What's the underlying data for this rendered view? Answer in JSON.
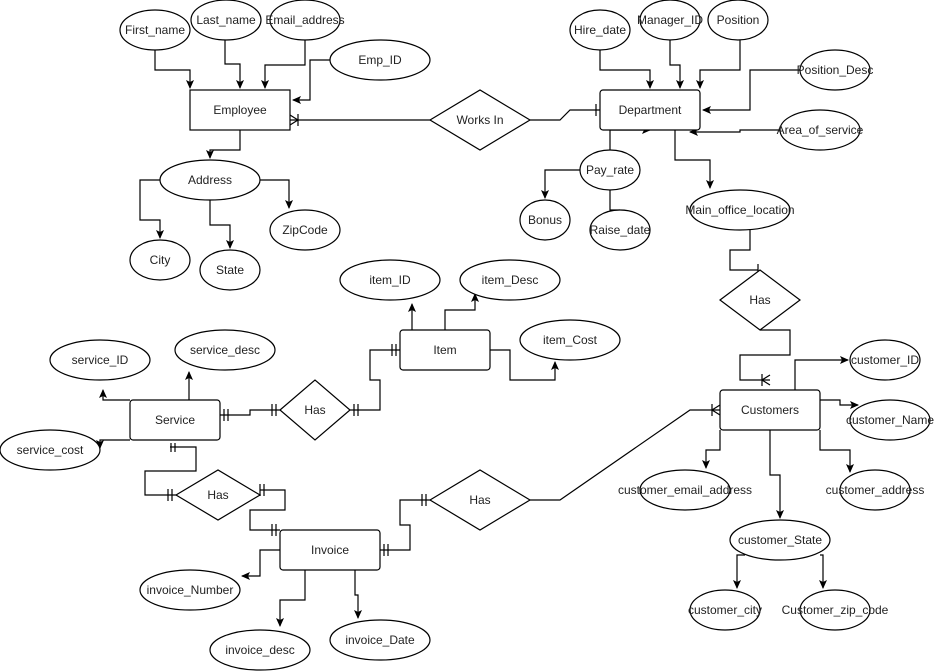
{
  "diagram": {
    "type": "ER diagram",
    "entities": {
      "employee": "Employee",
      "department": "Department",
      "item": "Item",
      "service": "Service",
      "invoice": "Invoice",
      "customers": "Customers"
    },
    "relationships": {
      "works_in": "Works In",
      "dept_customers_has": "Has",
      "service_item_has": "Has",
      "service_invoice_has": "Has",
      "invoice_customers_has": "Has"
    },
    "attributes": {
      "first_name": "First_name",
      "last_name": "Last_name",
      "email_address": "Email_address",
      "emp_id": "Emp_ID",
      "address": "Address",
      "city": "City",
      "state": "State",
      "zipcode": "ZipCode",
      "hire_date": "Hire_date",
      "manager_id": "Manager_ID",
      "position": "Position",
      "position_desc": "Position_Desc",
      "area_of_service": "Area_of_service",
      "pay_rate": "Pay_rate",
      "bonus": "Bonus",
      "raise_date": "Raise_date",
      "main_office_location": "Main_office_location",
      "item_id": "item_ID",
      "item_desc": "item_Desc",
      "item_cost": "item_Cost",
      "service_id": "service_ID",
      "service_desc": "service_desc",
      "service_cost": "service_cost",
      "invoice_number": "invoice_Number",
      "invoice_desc": "invoice_desc",
      "invoice_date": "invoice_Date",
      "customer_id": "customer_ID",
      "customer_name": "customer_Name",
      "customer_email_address": "customer_email_address",
      "customer_address": "customer_address",
      "customer_state": "customer_State",
      "customer_city": "customer_city",
      "customer_zip_code": "Customer_zip_code"
    },
    "relationship_cardinalities": [
      {
        "from": "Employee",
        "to": "Department",
        "via": "Works In",
        "from_end": "one-or-many",
        "to_end": "one"
      },
      {
        "from": "Department",
        "to": "Customers",
        "via": "Has",
        "from_end": "one",
        "to_end": "one-or-many"
      },
      {
        "from": "Service",
        "to": "Item",
        "via": "Has",
        "from_end": "one-and-only-one",
        "to_end": "one-and-only-one"
      },
      {
        "from": "Service",
        "to": "Invoice",
        "via": "Has",
        "from_end": "one-and-only-one",
        "to_end": "one-and-only-one"
      },
      {
        "from": "Invoice",
        "to": "Customers",
        "via": "Has",
        "from_end": "one-and-only-one",
        "to_end": "one-or-many"
      }
    ]
  }
}
